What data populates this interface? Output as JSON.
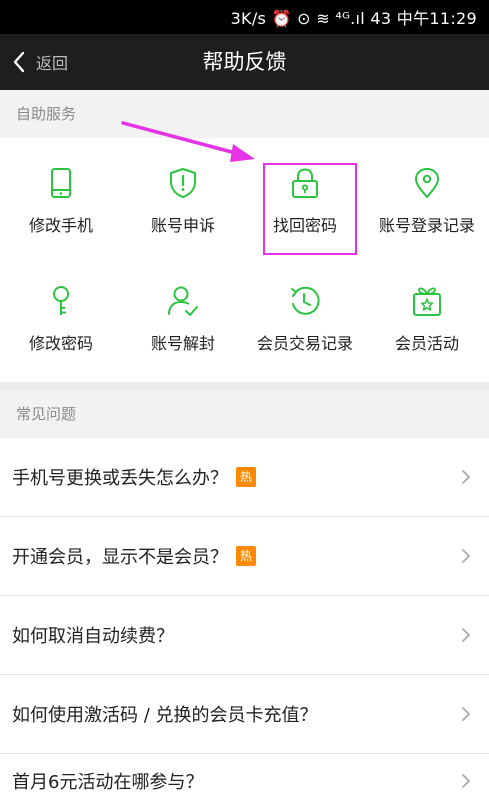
{
  "status": {
    "text": "3K/s ⏰ ⊙ ≋ ⁴ᴳ.ıl 43 中午11:29"
  },
  "header": {
    "back_label": "返回",
    "title": "帮助反馈"
  },
  "self_service": {
    "heading": "自助服务",
    "items": [
      {
        "label": "修改手机",
        "icon": "phone-icon"
      },
      {
        "label": "账号申诉",
        "icon": "shield-alert-icon"
      },
      {
        "label": "找回密码",
        "icon": "lock-icon"
      },
      {
        "label": "账号登录记录",
        "icon": "location-pin-icon"
      },
      {
        "label": "修改密码",
        "icon": "key-icon"
      },
      {
        "label": "账号解封",
        "icon": "user-check-icon"
      },
      {
        "label": "会员交易记录",
        "icon": "clock-history-icon"
      },
      {
        "label": "会员活动",
        "icon": "gift-icon"
      }
    ]
  },
  "faq": {
    "heading": "常见问题",
    "hot_badge": "热",
    "items": [
      {
        "question": "手机号更换或丢失怎么办？",
        "hot": true
      },
      {
        "question": "开通会员，显示不是会员？",
        "hot": true
      },
      {
        "question": "如何取消自动续费？",
        "hot": false
      },
      {
        "question": "如何使用激活码 / 兑换的会员卡充值？",
        "hot": false
      },
      {
        "question": "首月6元活动在哪参与？",
        "hot": false
      }
    ]
  },
  "colors": {
    "accent": "#2bc33f",
    "annotation": "#e733e6",
    "hot": "#ff8a00",
    "topbar": "#1e1e1e"
  }
}
